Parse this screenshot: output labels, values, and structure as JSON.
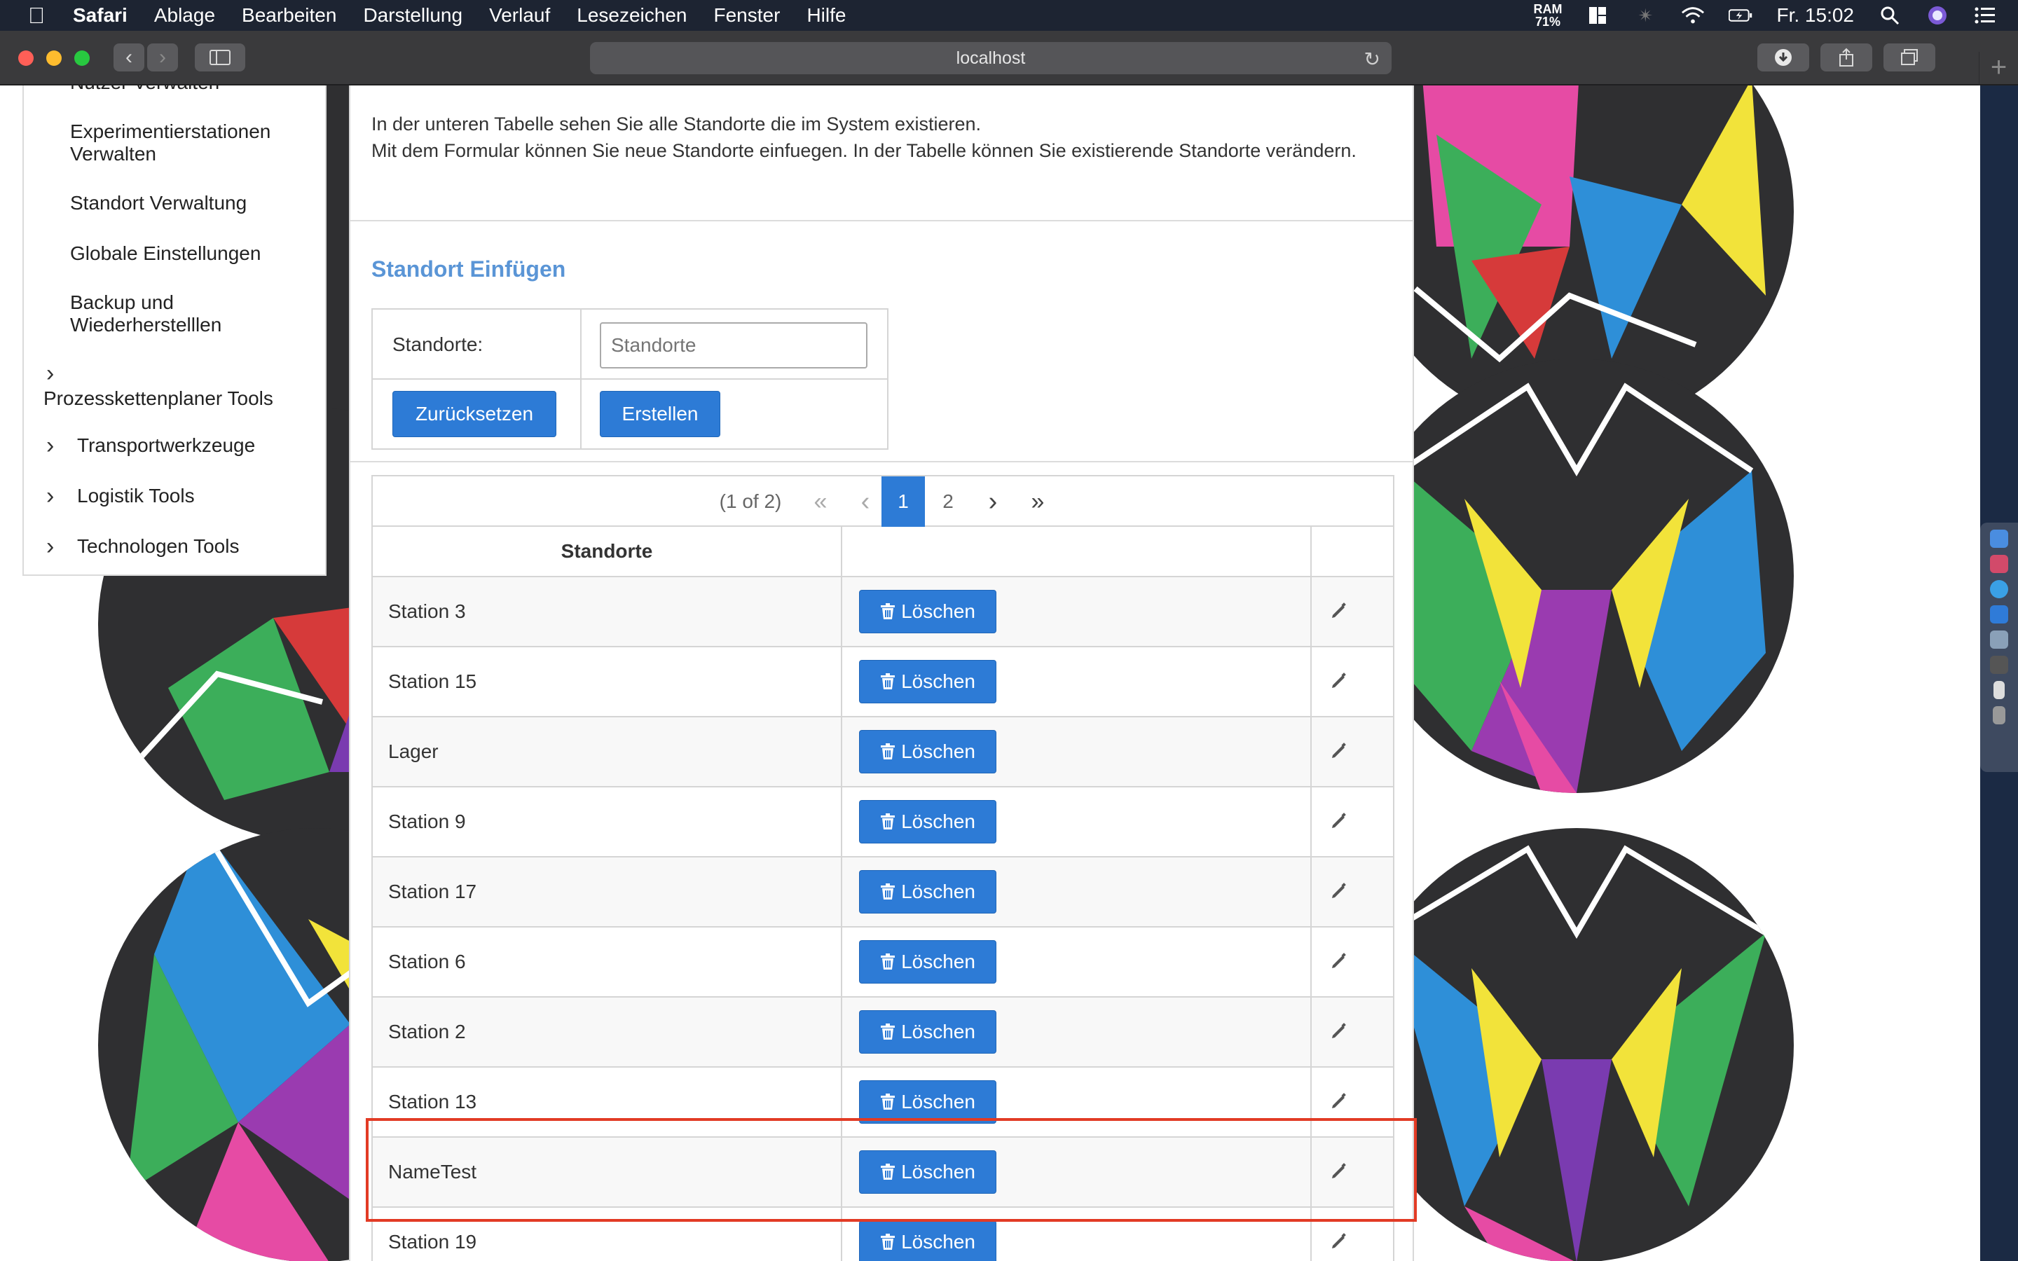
{
  "menubar": {
    "app_name": "Safari",
    "items": [
      "Ablage",
      "Bearbeiten",
      "Darstellung",
      "Verlauf",
      "Lesezeichen",
      "Fenster",
      "Hilfe"
    ],
    "ram_label": "RAM",
    "ram_value": "71%",
    "clock": "Fr. 15:02"
  },
  "browser": {
    "url": "localhost"
  },
  "sidebar": {
    "items": [
      {
        "label": "Nutzer Verwalten"
      },
      {
        "label": "Experimentierstationen Verwalten"
      },
      {
        "label": "Standort Verwaltung"
      },
      {
        "label": "Globale Einstellungen"
      },
      {
        "label": "Backup und Wiederherstelllen"
      }
    ],
    "groups": [
      {
        "label": "Prozesskettenplaner Tools"
      },
      {
        "label": "Transportwerkzeuge"
      },
      {
        "label": "Logistik Tools"
      },
      {
        "label": "Technologen Tools"
      }
    ]
  },
  "main": {
    "intro_line1": "In der unteren Tabelle sehen Sie alle Standorte die im System existieren.",
    "intro_line2": "Mit dem Formular können Sie neue Standorte einfuegen. In der Tabelle können Sie existierende Standorte verändern.",
    "section_title": "Standort Einfügen",
    "form": {
      "label": "Standorte:",
      "input_value": "",
      "input_placeholder": "Standorte",
      "reset_label": "Zurücksetzen",
      "create_label": "Erstellen"
    },
    "paginator": {
      "info": "(1 of 2)",
      "first": "«",
      "prev": "‹",
      "pages": [
        "1",
        "2"
      ],
      "current": "1",
      "next": "›",
      "last": "»"
    },
    "table": {
      "column_header": "Standorte",
      "delete_label": "Löschen",
      "rows": [
        "Station 3",
        "Station 15",
        "Lager",
        "Station 9",
        "Station 17",
        "Station 6",
        "Station 2",
        "Station 13",
        "NameTest",
        "Station 19"
      ]
    }
  },
  "colors": {
    "accent": "#2d7bd6",
    "section_title": "#5a95d6",
    "highlight": "#e23b25"
  },
  "icons": [
    "apple-icon",
    "back-icon",
    "forward-icon",
    "sidebar-icon",
    "reload-icon",
    "download-icon",
    "share-icon",
    "tabs-icon",
    "chevron-right-icon",
    "trash-icon",
    "pencil-icon"
  ]
}
